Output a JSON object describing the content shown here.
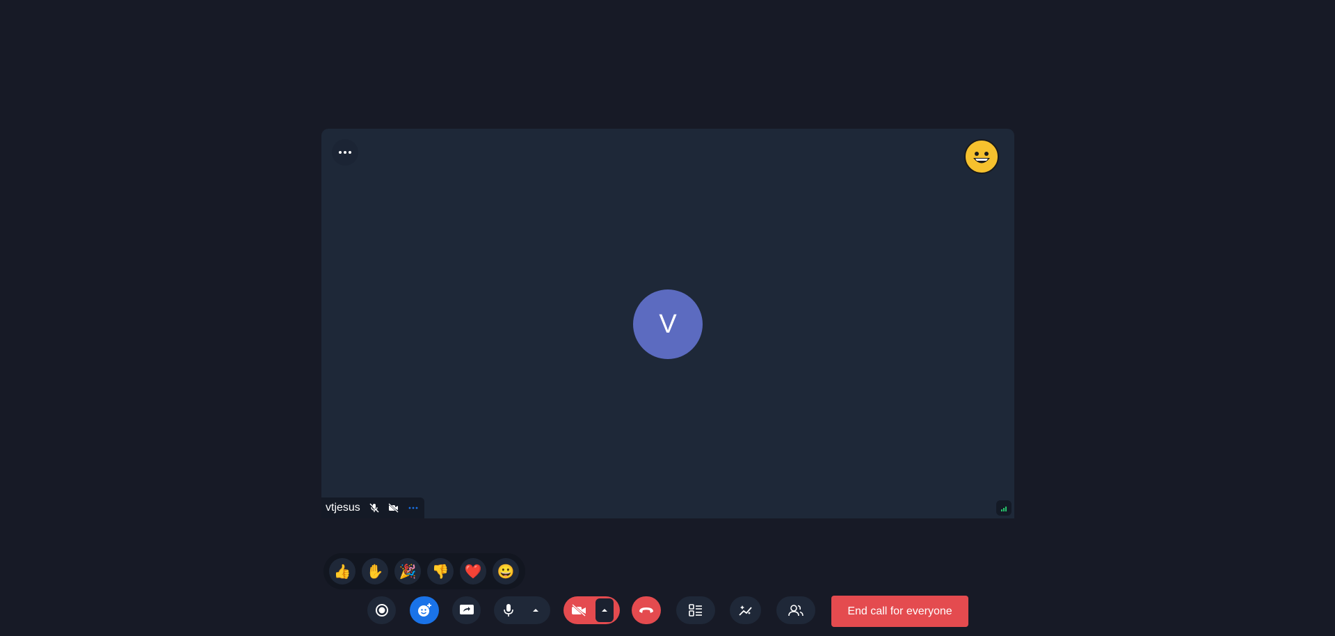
{
  "participant": {
    "name": "vtjesus",
    "avatar_letter": "V",
    "avatar_color": "#5c6bc0"
  },
  "reactions": [
    {
      "name": "thumbs-up",
      "glyph": "👍"
    },
    {
      "name": "raised-hand",
      "glyph": "✋"
    },
    {
      "name": "party-popper",
      "glyph": "🎉"
    },
    {
      "name": "thumbs-down",
      "glyph": "👎"
    },
    {
      "name": "heart",
      "glyph": "❤️"
    },
    {
      "name": "grinning-face",
      "glyph": "😀"
    }
  ],
  "toolbar": {
    "end_call_for_everyone_label": "End call for everyone"
  },
  "colors": {
    "background": "#171a26",
    "tile": "#1e2838",
    "danger": "#e44b4f",
    "accent": "#1a73e8"
  }
}
